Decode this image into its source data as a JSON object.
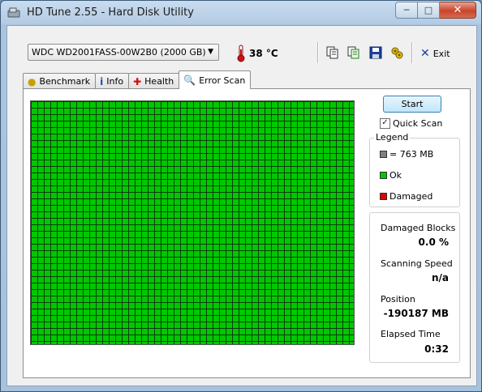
{
  "window": {
    "title": "HD Tune 2.55 - Hard Disk Utility"
  },
  "toolbar": {
    "drive": "WDC WD2001FASS-00W2B0 (2000 GB)",
    "temperature": "38 °C",
    "exit_label": "Exit"
  },
  "tabs": [
    {
      "label": "Benchmark",
      "active": false
    },
    {
      "label": "Info",
      "active": false
    },
    {
      "label": "Health",
      "active": false
    },
    {
      "label": "Error Scan",
      "active": true
    }
  ],
  "error_scan": {
    "start_label": "Start",
    "quick_scan_label": "Quick Scan",
    "quick_scan_checked": true,
    "legend": {
      "title": "Legend",
      "block_size": "= 763 MB",
      "ok": "Ok",
      "damaged": "Damaged"
    },
    "stats": {
      "damaged_blocks_label": "Damaged Blocks",
      "damaged_blocks_value": "0.0 %",
      "scanning_speed_label": "Scanning Speed",
      "scanning_speed_value": "n/a",
      "position_label": "Position",
      "position_value": "-190187 MB",
      "elapsed_label": "Elapsed Time",
      "elapsed_value": "0:32"
    }
  },
  "colors": {
    "ok": "#00c800",
    "damaged": "#e00000",
    "block": "#808080",
    "grid_line": "#0a3d0a"
  },
  "icons": [
    "hd-tune-app-icon",
    "thermometer-icon",
    "copy-icon",
    "copy-all-icon",
    "save-icon",
    "options-icon",
    "exit-icon",
    "benchmark-icon",
    "info-icon",
    "health-icon",
    "error-scan-icon"
  ]
}
